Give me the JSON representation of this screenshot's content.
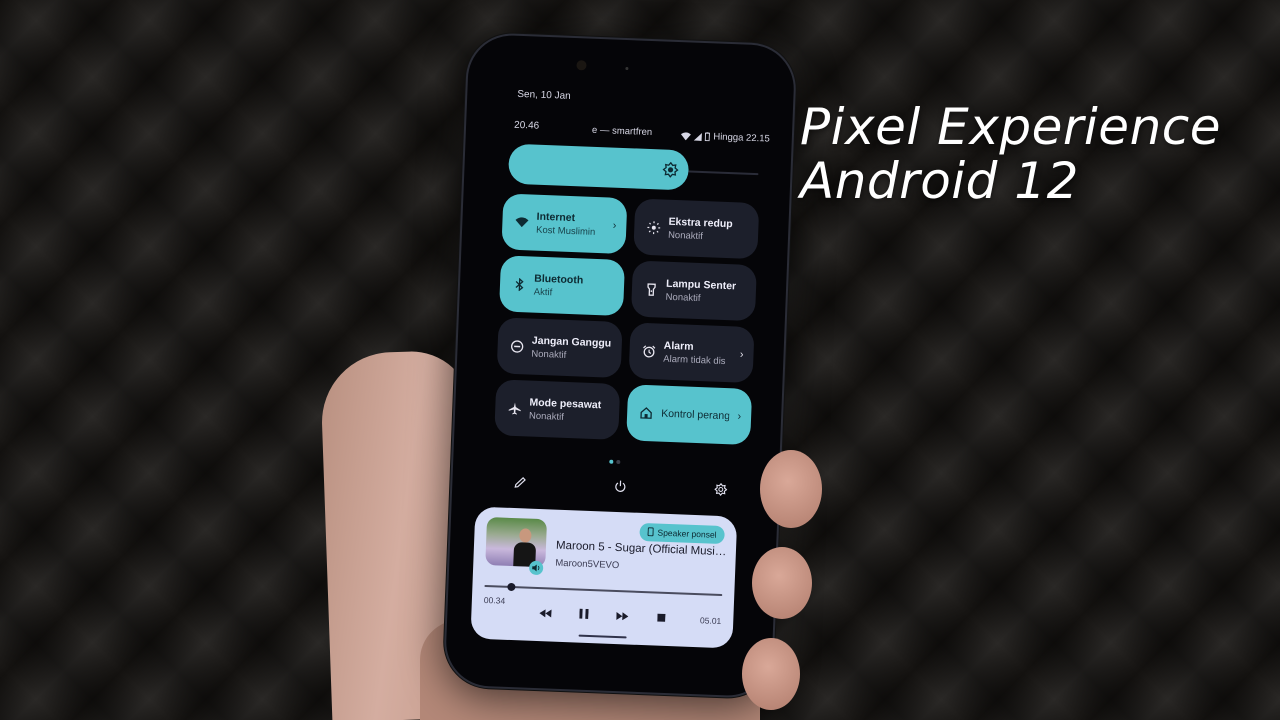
{
  "overlay_title": {
    "line1": "Pixel Experience",
    "line2": "Android 12"
  },
  "status_bar": {
    "date": "Sen, 10 Jan",
    "time": "20.46",
    "carrier": "e — smartfren",
    "battery_text": "Hingga 22.15",
    "icons": [
      "wifi-icon",
      "signal-icon",
      "battery-icon"
    ]
  },
  "brightness": {
    "level_percent": 72,
    "icon": "brightness-icon"
  },
  "tiles": [
    {
      "title": "Internet",
      "subtitle": "Kost Muslimin",
      "state": "on",
      "icon": "wifi-icon",
      "chevron": true
    },
    {
      "title": "Ekstra redup",
      "subtitle": "Nonaktif",
      "state": "off",
      "icon": "extra-dim-icon",
      "chevron": false
    },
    {
      "title": "Bluetooth",
      "subtitle": "Aktif",
      "state": "on",
      "icon": "bluetooth-icon",
      "chevron": false
    },
    {
      "title": "Lampu Senter",
      "subtitle": "Nonaktif",
      "state": "off",
      "icon": "flashlight-icon",
      "chevron": false
    },
    {
      "title": "Jangan Ganggu",
      "subtitle": "Nonaktif",
      "state": "off",
      "icon": "do-not-disturb-icon",
      "chevron": false
    },
    {
      "title": "Alarm",
      "subtitle": "Alarm tidak dis",
      "state": "off",
      "icon": "alarm-icon",
      "chevron": true
    },
    {
      "title": "Mode pesawat",
      "subtitle": "Nonaktif",
      "state": "off",
      "icon": "airplane-icon",
      "chevron": false
    },
    {
      "title": "Kontrol perang",
      "subtitle": "",
      "state": "on",
      "icon": "home-icon",
      "chevron": true
    }
  ],
  "pager": {
    "pages": 2,
    "active": 0
  },
  "actions": [
    "edit-icon",
    "power-icon",
    "settings-icon"
  ],
  "media": {
    "title": "Maroon 5 - Sugar (Official Music...",
    "artist": "Maroon5VEVO",
    "output_chip": "Speaker ponsel",
    "elapsed": "00.34",
    "total": "05.01",
    "progress_fraction": 0.113,
    "controls": [
      "rewind-icon",
      "pause-icon",
      "fast-forward-icon",
      "stop-icon"
    ]
  },
  "colors": {
    "accent": "#57c3cd",
    "tile_off": "#1c1f2b",
    "media_bg": "#d5dcf6"
  }
}
